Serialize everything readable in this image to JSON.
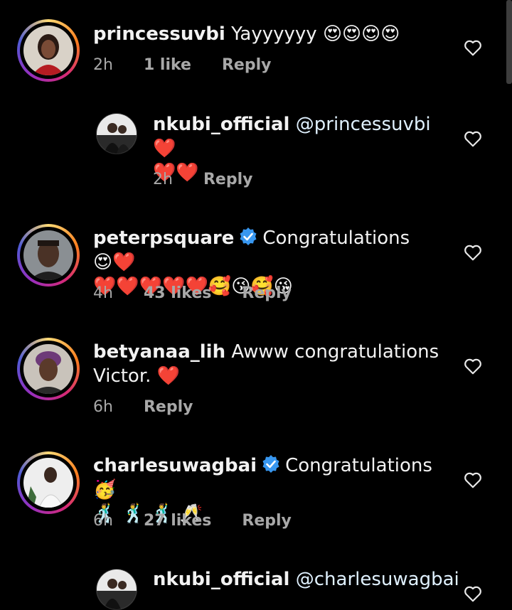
{
  "comments": [
    {
      "username": "princessuvbi",
      "text": "Yayyyyyy",
      "emojis": "😍😍😍😍",
      "time": "2h",
      "likes": "1 like",
      "reply": "Reply"
    },
    {
      "username": "nkubi_official",
      "mention": "@princessuvbi",
      "emojis_line1": "❤️",
      "emojis_line2": "❤️❤️",
      "time": "2h",
      "reply": "Reply"
    },
    {
      "username": "peterpsquare",
      "text": "Congratulations",
      "emojis_line1": "😍❤️",
      "emojis_line2": "❤️❤️❤️❤️❤️🥰😘🥰😘",
      "time": "4h",
      "likes": "43 likes",
      "reply": "Reply"
    },
    {
      "username": "betyanaa_lih",
      "text": "Awww congratulations",
      "text_line2": "Victor.",
      "emojis": "❤️",
      "time": "6h",
      "reply": "Reply"
    },
    {
      "username": "charlesuwagbai",
      "text": "Congratulations",
      "emojis_line1": "🥳",
      "emojis_line2": "🕺 🕺 🕺 🥂",
      "time": "6h",
      "likes": "27 likes",
      "reply": "Reply"
    },
    {
      "username": "nkubi_official",
      "mention": "@charlesuwagbai"
    }
  ],
  "colors": {
    "background": "#000000",
    "text": "#f2f2f2",
    "meta": "#a8a8a8",
    "verified": "#3897f0",
    "heart": "#e0245e"
  }
}
